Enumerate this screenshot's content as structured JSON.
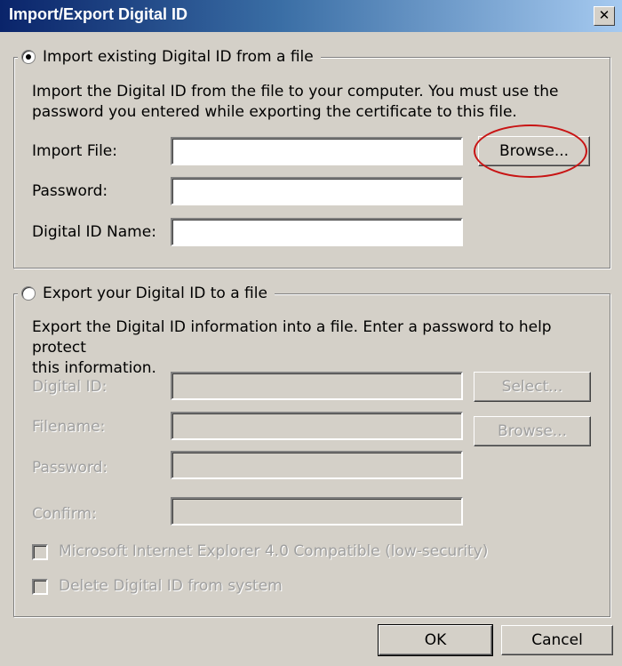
{
  "window": {
    "title": "Import/Export Digital ID",
    "close_glyph": "✕",
    "titlebar_colors": [
      "#0a246a",
      "#3a6ea5",
      "#a6caf0"
    ]
  },
  "import_section": {
    "legend": "Import existing Digital ID from a file",
    "selected": true,
    "description_line1": "Import the Digital ID from the file to your computer. You must use the",
    "description_line2": "password you entered while exporting the certificate to this file.",
    "fields": {
      "import_file_label": "Import File:",
      "import_file_value": "",
      "password_label": "Password:",
      "password_value": "",
      "digital_id_name_label": "Digital ID Name:",
      "digital_id_name_value": ""
    },
    "browse_label": "Browse...",
    "highlight_color": "#c81414"
  },
  "export_section": {
    "legend": "Export your Digital ID to a file",
    "selected": false,
    "description_line1": "Export the Digital ID information into a file. Enter a password to help protect",
    "description_line2": "this information.",
    "fields": {
      "digital_id_label": "Digital ID:",
      "filename_label": "Filename:",
      "password_label": "Password:",
      "confirm_label": "Confirm:"
    },
    "select_label": "Select...",
    "browse_label": "Browse...",
    "checkboxes": {
      "ie4_compatible": "Microsoft Internet Explorer 4.0 Compatible (low-security)",
      "delete_id": "Delete Digital ID from system"
    }
  },
  "footer": {
    "ok_label": "OK",
    "cancel_label": "Cancel"
  }
}
